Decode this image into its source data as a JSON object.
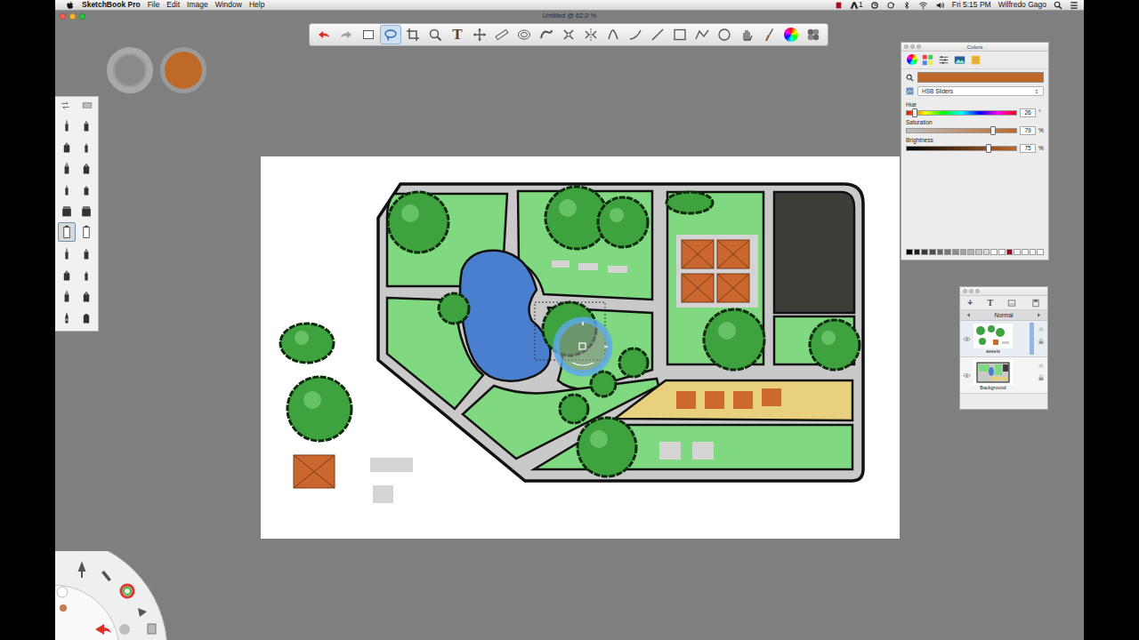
{
  "menubar": {
    "app": "SketchBook Pro",
    "menus": [
      "File",
      "Edit",
      "Image",
      "Window",
      "Help"
    ],
    "status_badge": "1",
    "clock": "Fri 5:15 PM",
    "user": "Wilfredo Gago"
  },
  "window": {
    "title": "Untitled @ 62.0 %"
  },
  "toolbar": {
    "tools": [
      {
        "selected": false
      },
      {
        "selected": false
      },
      {
        "selected": false
      },
      {
        "selected": true
      },
      {
        "selected": false
      },
      {
        "selected": false
      },
      {
        "selected": false,
        "glyph": "T"
      },
      {
        "selected": false
      },
      {
        "selected": false
      },
      {
        "selected": false
      },
      {
        "selected": false
      },
      {
        "selected": false
      },
      {
        "selected": false
      },
      {
        "selected": false
      },
      {
        "selected": false
      },
      {
        "selected": false
      },
      {
        "selected": false
      },
      {
        "selected": false
      },
      {
        "selected": false
      },
      {
        "selected": false
      },
      {
        "selected": false
      },
      {
        "selected": false
      },
      {
        "selected": false
      }
    ]
  },
  "brush_palette": {
    "brushes": [
      {
        "selected": false
      },
      {
        "selected": false
      },
      {
        "selected": false
      },
      {
        "selected": false
      },
      {
        "selected": false
      },
      {
        "selected": false
      },
      {
        "selected": false
      },
      {
        "selected": false
      },
      {
        "selected": false
      },
      {
        "selected": false
      },
      {
        "selected": true
      },
      {
        "selected": false
      },
      {
        "selected": false
      },
      {
        "selected": false
      },
      {
        "selected": false
      },
      {
        "selected": false
      },
      {
        "selected": false
      },
      {
        "selected": false
      },
      {
        "selected": false
      },
      {
        "selected": false
      }
    ]
  },
  "current_color": "#bf6928",
  "colors_panel": {
    "title": "Colors",
    "mode": "HSB Sliders",
    "sliders": [
      {
        "label": "Hue",
        "value": "26",
        "unit": "°",
        "level": 0.07
      },
      {
        "label": "Saturation",
        "value": "79",
        "unit": "%",
        "level": 0.79
      },
      {
        "label": "Brightness",
        "value": "75",
        "unit": "%",
        "level": 0.75
      }
    ],
    "swatches": [
      {
        "color": "#000000"
      },
      {
        "color": "#1e1e1e"
      },
      {
        "color": "#3a3a3a"
      },
      {
        "color": "#505050"
      },
      {
        "color": "#646464"
      },
      {
        "color": "#787878"
      },
      {
        "color": "#8c8c8c"
      },
      {
        "color": "#a0a0a0"
      },
      {
        "color": "#b4b4b4"
      },
      {
        "color": "#c8c8c8"
      },
      {
        "color": "#dcdcdc"
      },
      {
        "color": "#ffffff"
      },
      {
        "color": "#ffffff"
      },
      {
        "color": "#8c1020"
      },
      {
        "color": "#ffffff"
      },
      {
        "color": "#ffffff"
      },
      {
        "color": "#ffffff"
      },
      {
        "color": "#ffffff"
      }
    ]
  },
  "layers_panel": {
    "tool_glyphs": [
      "+",
      "T"
    ],
    "blend_mode": "Normal",
    "layers": [
      {
        "name": "assets",
        "selected": true,
        "visible": true
      },
      {
        "name": "Background",
        "selected": false,
        "visible": true
      }
    ]
  }
}
